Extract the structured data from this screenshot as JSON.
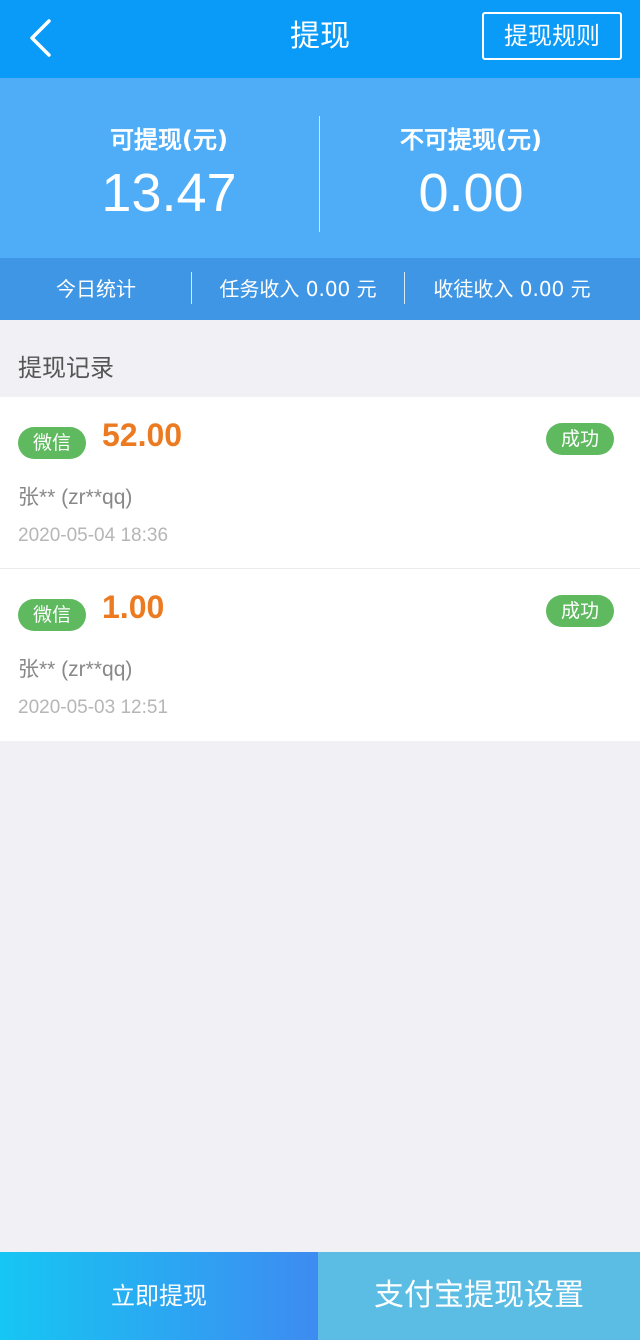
{
  "header": {
    "title": "提现",
    "rules_label": "提现规则",
    "back_icon": "chevron-left-icon"
  },
  "balance": {
    "available_label": "可提现(元)",
    "available_value": "13.47",
    "unavailable_label": "不可提现(元)",
    "unavailable_value": "0.00"
  },
  "stats": {
    "today_label": "今日统计",
    "task_income": "任务收入 0.00 元",
    "apprentice_income": "收徒收入 0.00 元"
  },
  "records": {
    "section_title": "提现记录",
    "items": [
      {
        "method": "微信",
        "amount": "52.00",
        "status": "成功",
        "account": "张** (zr**qq)",
        "time": "2020-05-04 18:36"
      },
      {
        "method": "微信",
        "amount": "1.00",
        "status": "成功",
        "account": "张** (zr**qq)",
        "time": "2020-05-03 12:51"
      }
    ]
  },
  "footer": {
    "withdraw_label": "立即提现",
    "alipay_settings_label": "支付宝提现设置"
  },
  "colors": {
    "header_bg": "#0a9af7",
    "balance_bg": "#4fadf8",
    "stats_bg": "#3e96e5",
    "amount": "#ec7a20",
    "badge_green": "#5fba5f"
  }
}
